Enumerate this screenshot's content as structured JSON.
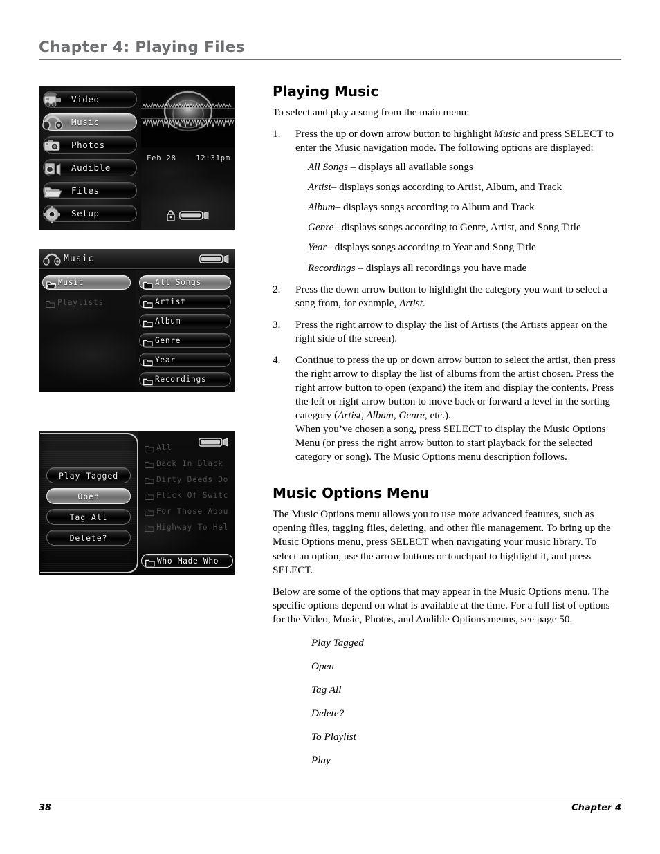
{
  "header": {
    "chapter_title": "Chapter 4: Playing Files"
  },
  "footer": {
    "page_number": "38",
    "chapter_label": "Chapter  4"
  },
  "content": {
    "section1_title": "Playing Music",
    "intro": "To select and play a song from the main menu:",
    "steps": [
      {
        "num": "1.",
        "text_before": "Press the up or down arrow button to highlight ",
        "italic": "Music",
        "text_after": " and press SELECT to enter the Music navigation mode. The following options are displayed:",
        "sub_items": [
          {
            "term": "All Songs",
            "desc": " – displays all available songs"
          },
          {
            "term": "Artist",
            "desc": "– displays songs according to Artist, Album, and Track"
          },
          {
            "term": "Album",
            "desc": "– displays songs according to Album and Track"
          },
          {
            "term": "Genre",
            "desc": "– displays songs according to Genre, Artist, and Song Title"
          },
          {
            "term": "Year",
            "desc": "– displays songs according to Year and Song Title"
          },
          {
            "term": "Recordings",
            "desc": " – displays all recordings you have made"
          }
        ]
      },
      {
        "num": "2.",
        "text_before": "Press the down arrow button to highlight the category you want to select a song from, for example, ",
        "italic": "Artist",
        "text_after": "."
      },
      {
        "num": "3.",
        "text_before": "Press the right arrow to display the list of Artists (the Artists appear on the right side of the screen).",
        "italic": "",
        "text_after": ""
      },
      {
        "num": "4.",
        "text_before": "Continue to press the up or down arrow button to select the artist, then press the right arrow to display the list of albums from the artist chosen. Press the right arrow button to open (expand) the item and display the contents. Press the left or right arrow button to move back or forward a level in the sorting category (",
        "italic": "Artist, Album, Genre",
        "text_after": ", etc.).",
        "continuation": "When you’ve chosen a song, press SELECT to display the Music Options Menu (or press the right arrow button to start playback for the selected category or song). The Music Options menu description follows."
      }
    ],
    "section2_title": "Music Options Menu",
    "para1": "The Music Options menu allows you to use more advanced features, such as opening files, tagging files, deleting, and other file management. To bring up the Music Options menu, press SELECT when navigating your music library. To select an option, use the arrow buttons or touchpad to highlight it, and press SELECT.",
    "para2": "Below are some of the options that may appear in the Music Options menu.  The specific options depend on what is available at the time. For a full list of options for the Video, Music, Photos, and Audible Options menus, see page 50.",
    "options": [
      "Play Tagged",
      "Open",
      "Tag All",
      "Delete?",
      "To Playlist",
      "Play"
    ]
  },
  "screenshots": {
    "main_menu": {
      "items": [
        {
          "label": "Video",
          "icon": "camcorder-icon",
          "selected": false
        },
        {
          "label": "Music",
          "icon": "headphones-icon",
          "selected": true
        },
        {
          "label": "Photos",
          "icon": "camera-icon",
          "selected": false
        },
        {
          "label": "Audible",
          "icon": "speaker-icon",
          "selected": false
        },
        {
          "label": "Files",
          "icon": "folder-icon",
          "selected": false
        },
        {
          "label": "Setup",
          "icon": "gear-icon",
          "selected": false
        }
      ],
      "status": {
        "date": "Feb 28",
        "time": "12:31pm",
        "lock_icon": "lock-icon",
        "battery_icon": "battery-icon"
      }
    },
    "music_nav": {
      "title": "Music",
      "title_icon": "headphones-icon",
      "battery_icon": "battery-icon",
      "left_items": [
        {
          "label": "Music",
          "selected": true,
          "dim": false
        },
        {
          "label": "Playlists",
          "selected": false,
          "dim": true
        }
      ],
      "right_items": [
        {
          "label": "All Songs",
          "selected": true
        },
        {
          "label": "Artist",
          "selected": false
        },
        {
          "label": "Album",
          "selected": false
        },
        {
          "label": "Genre",
          "selected": false
        },
        {
          "label": "Year",
          "selected": false
        },
        {
          "label": "Recordings",
          "selected": false
        }
      ]
    },
    "music_options": {
      "battery_icon": "battery-icon",
      "buttons": [
        {
          "label": "Play Tagged",
          "selected": false
        },
        {
          "label": "Open",
          "selected": true
        },
        {
          "label": "Tag All",
          "selected": false
        },
        {
          "label": "Delete?",
          "selected": false
        }
      ],
      "albums": [
        {
          "label": "All",
          "selected": false
        },
        {
          "label": "Back In Black",
          "selected": false
        },
        {
          "label": "Dirty Deeds Do",
          "selected": false
        },
        {
          "label": "Flick Of Switc",
          "selected": false
        },
        {
          "label": "For Those Abou",
          "selected": false
        },
        {
          "label": "Highway To Hel",
          "selected": false
        },
        {
          "label": "Who Made Who",
          "selected": true
        }
      ]
    }
  }
}
